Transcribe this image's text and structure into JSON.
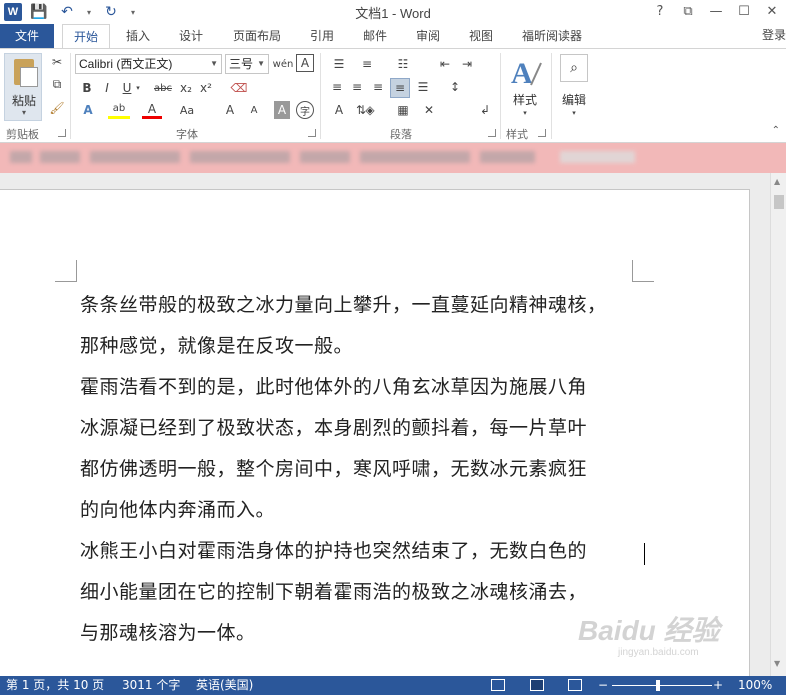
{
  "app": {
    "title": "文档1 - Word",
    "logo": "W",
    "quick_access": {
      "save": "💾",
      "undo": "↶",
      "redo": "↻",
      "more": "▾"
    },
    "window_buttons": {
      "help": "?",
      "restore_ribbon": "⧉",
      "minimize": "—",
      "maximize": "☐",
      "close": "✕"
    },
    "sign_in": "登录"
  },
  "tabs": [
    {
      "label": "文件"
    },
    {
      "label": "开始"
    },
    {
      "label": "插入"
    },
    {
      "label": "设计"
    },
    {
      "label": "页面布局"
    },
    {
      "label": "引用"
    },
    {
      "label": "邮件"
    },
    {
      "label": "审阅"
    },
    {
      "label": "视图"
    },
    {
      "label": "福昕阅读器"
    }
  ],
  "ribbon": {
    "clipboard": {
      "label": "剪贴板",
      "paste": "粘贴",
      "paste_arrow": "▾"
    },
    "font": {
      "label": "字体",
      "font_name": "Calibri (西文正文)",
      "font_size": "三号",
      "buttons": [
        "B",
        "I",
        "U",
        "abc",
        "x₂",
        "x²",
        "A",
        "ab",
        "A",
        "Aa",
        "A",
        "A",
        "A",
        "字"
      ]
    },
    "paragraph": {
      "label": "段落"
    },
    "styles": {
      "label": "样式",
      "button": "样式"
    },
    "editing": {
      "button": "编辑"
    }
  },
  "document": {
    "lines": [
      "条条丝带般的极致之冰力量向上攀升，一直蔓延向精神魂核，",
      "那种感觉，就像是在反攻一般。",
      "霍雨浩看不到的是，此时他体外的八角玄冰草因为施展八角",
      "冰源凝已经到了极致状态，本身剧烈的颤抖着，每一片草叶",
      "都仿佛透明一般，整个房间中，寒风呼啸，无数冰元素疯狂",
      "的向他体内奔涌而入。",
      "冰熊王小白对霍雨浩身体的护持也突然结束了，无数白色的",
      "细小能量团在它的控制下朝着霍雨浩的极致之冰魂核涌去，",
      "与那魂核溶为一体。"
    ]
  },
  "watermark": {
    "text": "Baidu 经验",
    "sub": "jingyan.baidu.com"
  },
  "status": {
    "page": "第 1 页，共 10 页",
    "words": "3011 个字",
    "language": "英语(美国)",
    "zoom_minus": "−",
    "zoom_plus": "+",
    "zoom": "100%"
  },
  "colors": {
    "accent": "#2b579a",
    "infobar": "#f2b8b8"
  }
}
